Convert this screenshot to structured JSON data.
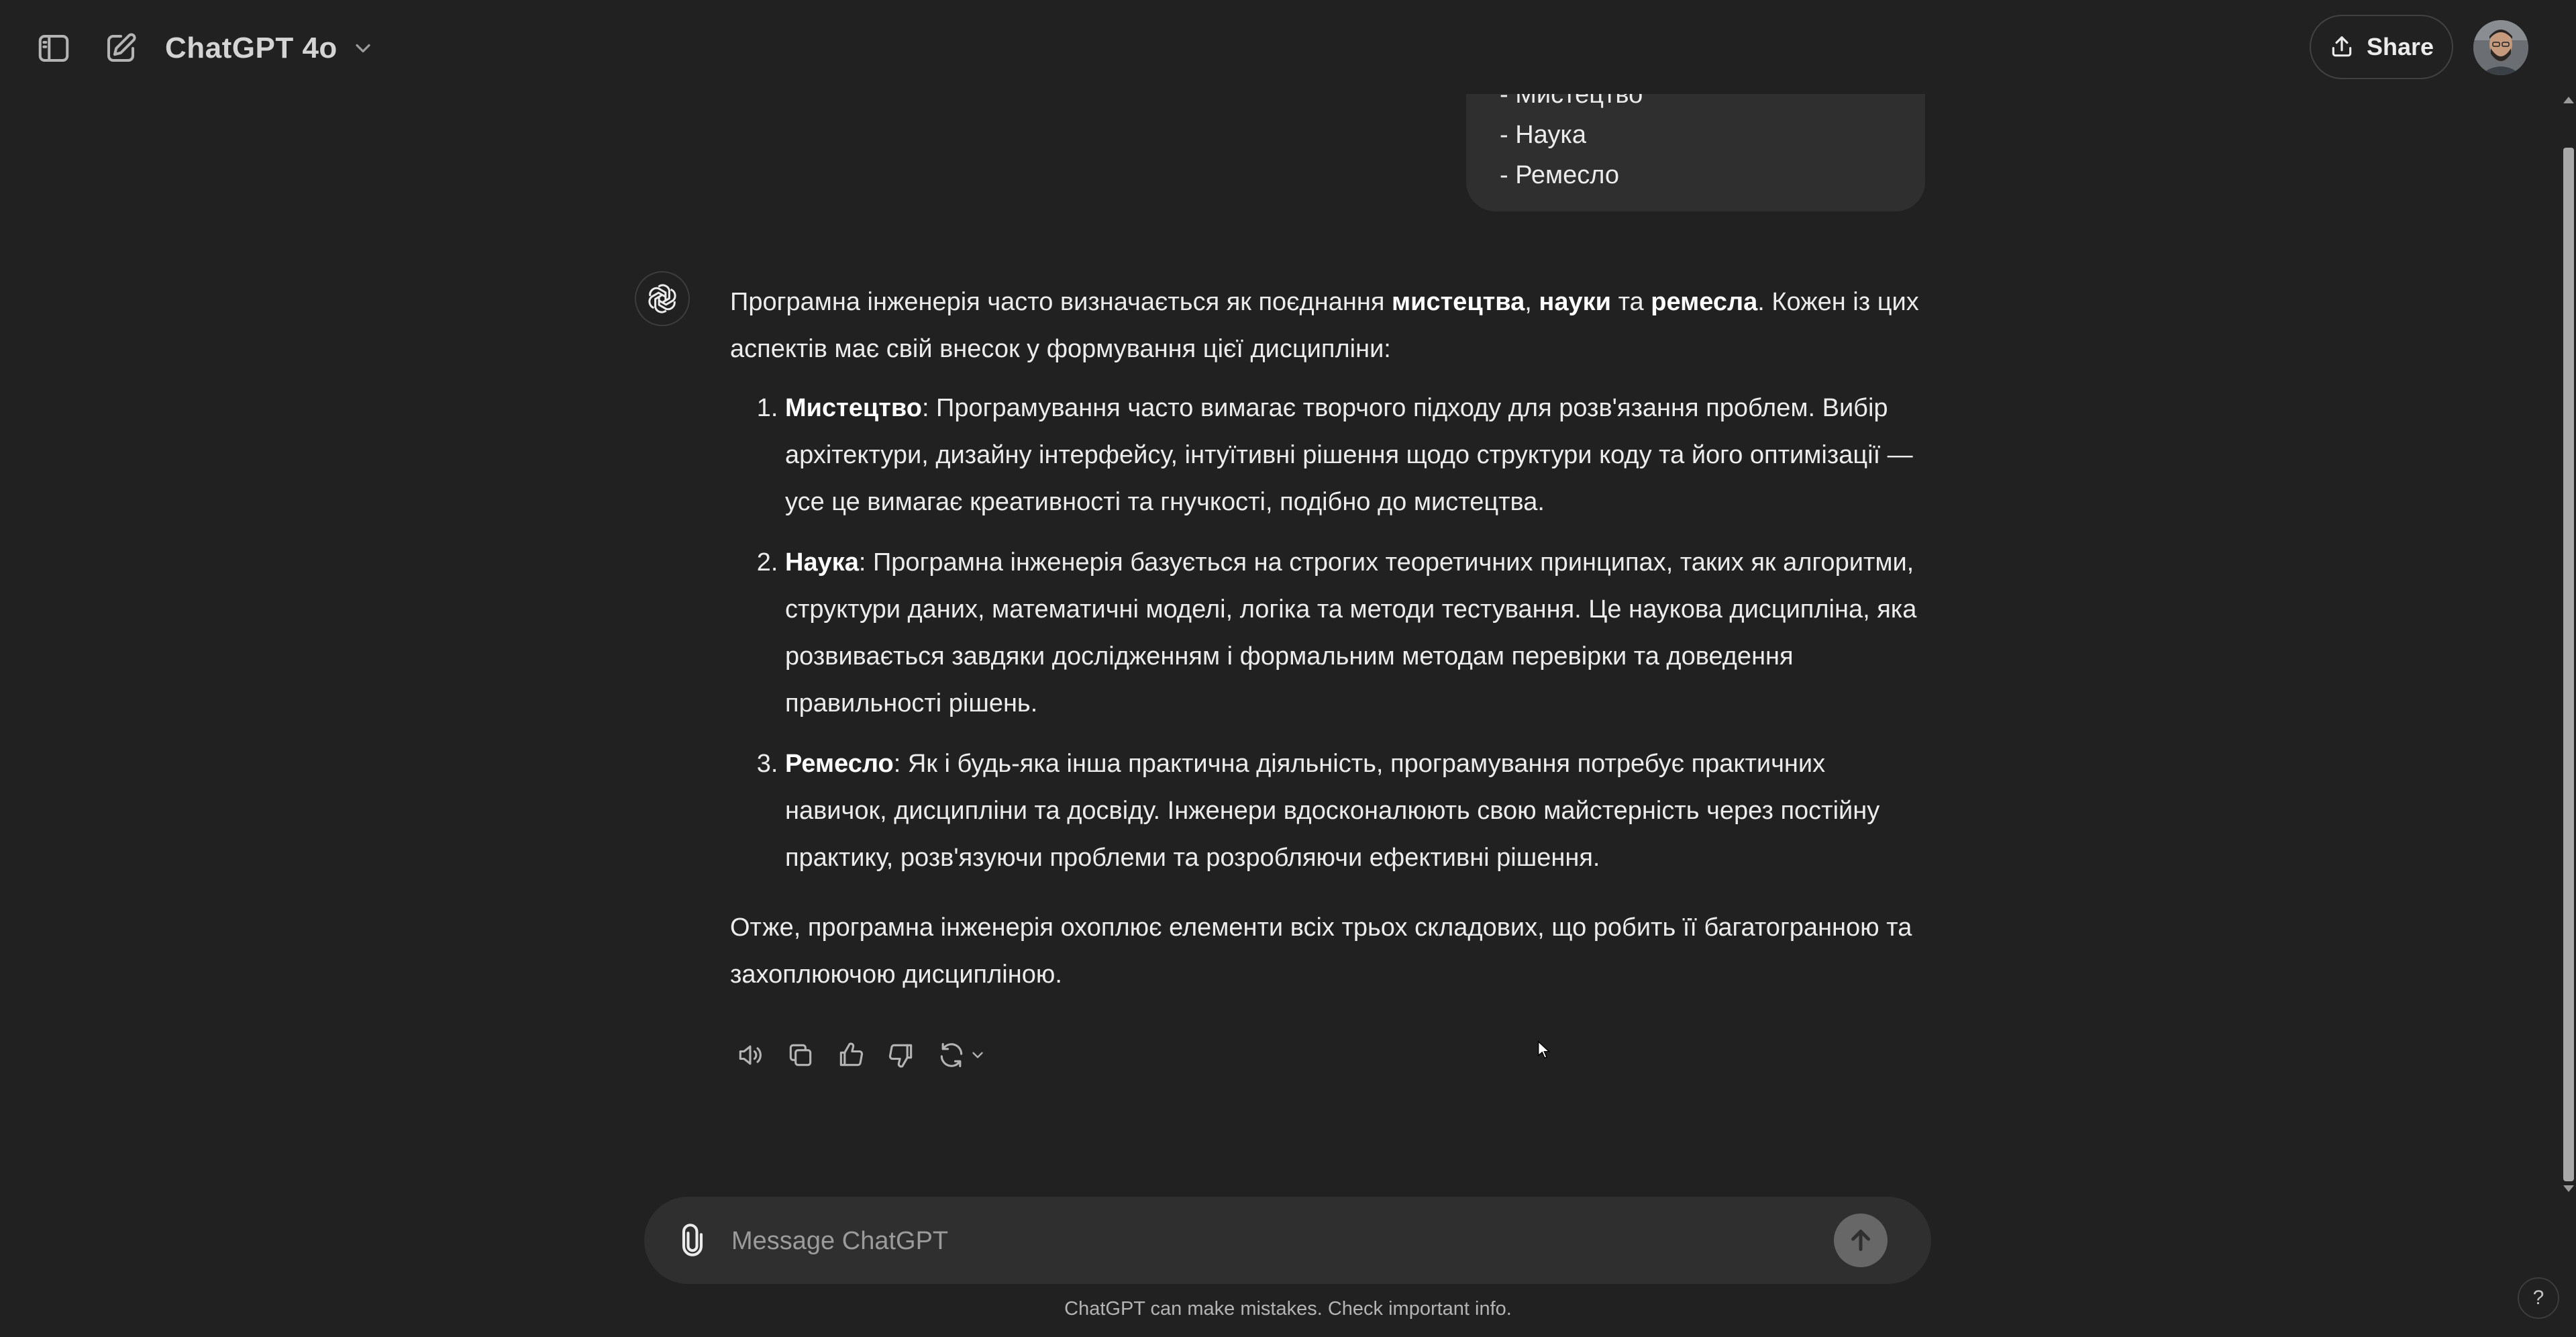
{
  "header": {
    "model_name": "ChatGPT 4o",
    "share_label": "Share",
    "icons": {
      "sidebar": "sidebar-toggle-icon",
      "new_chat": "new-chat-edit-icon",
      "model_chevron": "chevron-down-icon",
      "share": "share-upload-icon"
    }
  },
  "user_message": {
    "lines": [
      "- Мистецтво",
      "- Наука",
      "- Ремесло"
    ]
  },
  "assistant_message": {
    "intro": {
      "t1": "Програмна інженерія часто визначається як поєднання ",
      "b1": "мистецтва",
      "t2": ", ",
      "b2": "науки",
      "t3": " та ",
      "b3": "ремесла",
      "t4": ". Кожен із цих аспектів має свій внесок у формування цієї дисципліни:"
    },
    "items": [
      {
        "title": "Мистецтво",
        "text": ": Програмування часто вимагає творчого підходу для розв'язання проблем. Вибір архітектури, дизайну інтерфейсу, інтуїтивні рішення щодо структури коду та його оптимізації — усе це вимагає креативності та гнучкості, подібно до мистецтва."
      },
      {
        "title": "Наука",
        "text": ": Програмна інженерія базується на строгих теоретичних принципах, таких як алгоритми, структури даних, математичні моделі, логіка та методи тестування. Це наукова дисципліна, яка розвивається завдяки дослідженням і формальним методам перевірки та доведення правильності рішень."
      },
      {
        "title": "Ремесло",
        "text": ": Як і будь-яка інша практична діяльність, програмування потребує практичних навичок, дисципліни та досвіду. Інженери вдосконалюють свою майстерність через постійну практику, розв'язуючи проблеми та розробляючи ефективні рішення."
      }
    ],
    "closing": "Отже, програмна інженерія охоплює елементи всіх трьох складових, що робить її багатогранною та захоплюючою дисципліною."
  },
  "actions": [
    "read-aloud-icon",
    "copy-icon",
    "thumbs-up-icon",
    "thumbs-down-icon",
    "regenerate-icon"
  ],
  "composer": {
    "placeholder": "Message ChatGPT",
    "value": ""
  },
  "disclaimer": "ChatGPT can make mistakes. Check important info.",
  "help_label": "?",
  "colors": {
    "background": "#212121",
    "bubble": "#2f2f2f",
    "text": "#ececec",
    "muted": "#9b9b9b",
    "send_button": "#676767"
  }
}
